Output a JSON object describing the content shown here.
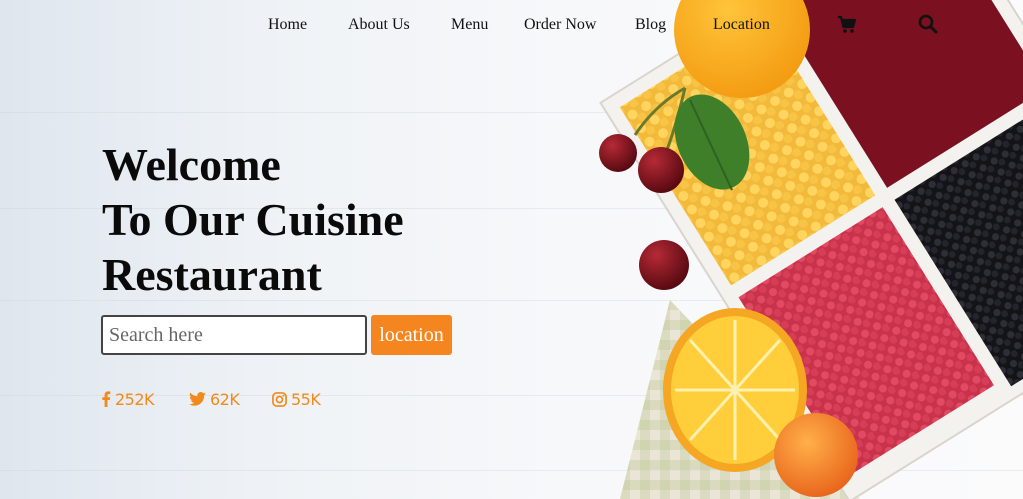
{
  "nav": {
    "items": [
      {
        "label": "Home"
      },
      {
        "label": "About Us"
      },
      {
        "label": "Menu"
      },
      {
        "label": "Order Now"
      },
      {
        "label": "Blog"
      },
      {
        "label": "Location"
      }
    ],
    "cart_icon": "cart-icon",
    "search_icon": "magnifier-icon"
  },
  "hero": {
    "title_lines": [
      "Welcome",
      "To Our Cuisine",
      "Restaurant"
    ]
  },
  "search": {
    "placeholder": "Search here",
    "value": "",
    "button_label": "location"
  },
  "social": [
    {
      "icon": "facebook-icon",
      "count": "252K"
    },
    {
      "icon": "twitter-icon",
      "count": "62K"
    },
    {
      "icon": "instagram-icon",
      "count": "55K"
    }
  ],
  "colors": {
    "accent": "#f5861f",
    "text": "#111111",
    "background": "#f4f6f8"
  },
  "image": {
    "icon": "fruit-tray-illustration"
  }
}
